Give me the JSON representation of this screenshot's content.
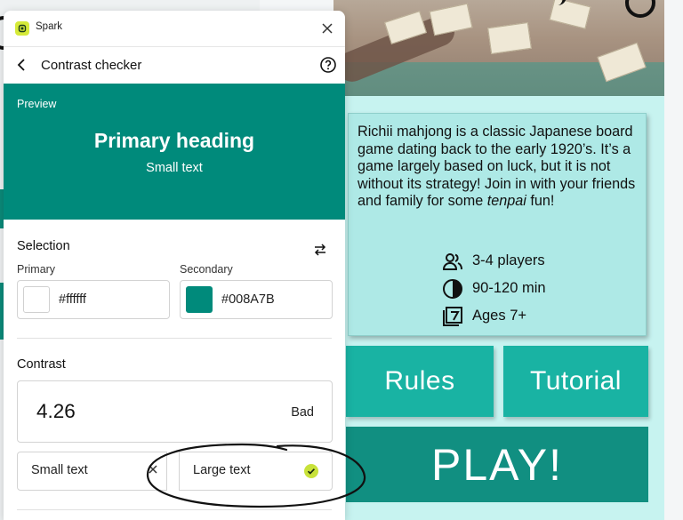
{
  "panel": {
    "app_name": "Spark",
    "header_title": "Contrast checker",
    "preview": {
      "label": "Preview",
      "heading": "Primary heading",
      "small_text": "Small text"
    },
    "selection": {
      "title": "Selection",
      "primary_label": "Primary",
      "primary_value": "#ffffff",
      "secondary_label": "Secondary",
      "secondary_value": "#008A7B"
    },
    "contrast": {
      "title": "Contrast",
      "ratio": "4.26",
      "verdict": "Bad",
      "small_text_label": "Small text",
      "large_text_label": "Large text"
    }
  },
  "game": {
    "description_1": "Richii mahjong is a classic Japanese board game dating back to the early 1920’s. It’s a game largely based on luck, but it is not without its strategy! Join in with your friends and family for some ",
    "description_em": "tenpai",
    "description_2": " fun!",
    "players": "3-4 players",
    "duration": "90-120 min",
    "ages": "Ages 7+",
    "rules_label": "Rules",
    "tutorial_label": "Tutorial",
    "play_label": "PLAY!"
  },
  "colors": {
    "primary": "#ffffff",
    "secondary": "#008A7B",
    "accent_lime": "#c8e23a",
    "game_teal": "#19b3a3",
    "play_teal": "#118f81"
  },
  "icons": [
    "spark-logo-icon",
    "close-icon",
    "back-arrow-icon",
    "help-icon",
    "swap-icon",
    "x-icon",
    "check-icon",
    "people-icon",
    "clock-icon",
    "age-icon"
  ]
}
